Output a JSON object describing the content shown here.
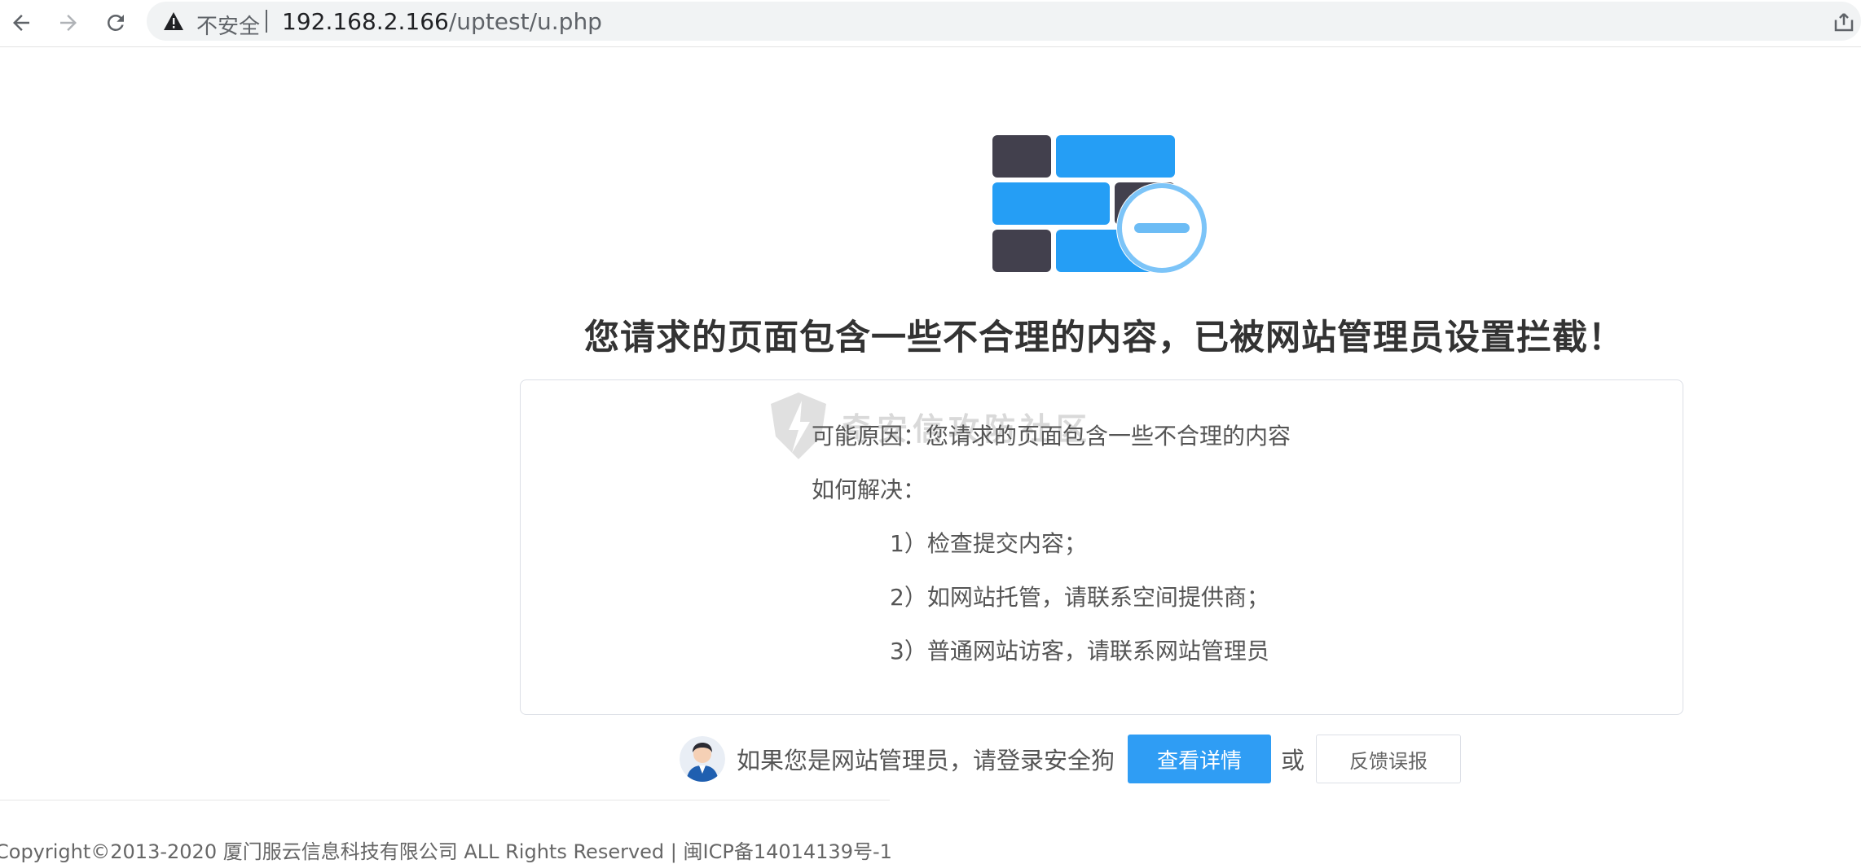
{
  "browser": {
    "back_icon": "arrow-left-icon",
    "forward_icon": "arrow-right-icon",
    "reload_icon": "reload-icon",
    "security_label": "不安全",
    "url_host": "192.168.2.166",
    "url_path": "/uptest/u.php",
    "share_icon": "share-icon"
  },
  "page": {
    "logo_icon": "firewall-block-icon",
    "headline": "您请求的页面包含一些不合理的内容，已被网站管理员设置拦截！",
    "watermark": "奇安信攻防社区",
    "reason_label": "可能原因：",
    "reason_text": "您请求的页面包含一些不合理的内容",
    "solution_label": "如何解决：",
    "solutions": [
      "1）检查提交内容；",
      "2）如网站托管，请联系空间提供商；",
      "3）普通网站访客，请联系网站管理员"
    ],
    "admin_prompt": "如果您是网站管理员，请登录安全狗",
    "details_button": "查看详情",
    "or_text": "或",
    "feedback_button": "反馈误报",
    "copyright": "Copyright©2013-2020 厦门服云信息科技有限公司 ALL Rights Reserved | 闽ICP备14014139号-1"
  },
  "colors": {
    "brand_blue": "#2f9df4",
    "brick_dark": "#42404d",
    "brick_blue": "#259ef5"
  }
}
